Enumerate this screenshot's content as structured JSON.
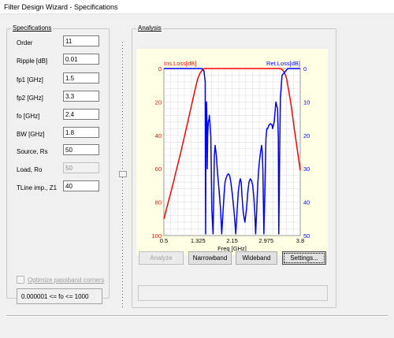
{
  "window": {
    "title": "Filter Design Wizard - Specifications"
  },
  "specifications": {
    "title": "Specifications",
    "fields": [
      {
        "label": "Order",
        "value": "11",
        "enabled": true
      },
      {
        "label": "Ripple [dB]",
        "value": "0.01",
        "enabled": true
      },
      {
        "label": "fp1 [GHz]",
        "value": "1.5",
        "enabled": true
      },
      {
        "label": "fp2 [GHz]",
        "value": "3.3",
        "enabled": true
      },
      {
        "label": "fo [GHz]",
        "value": "2.4",
        "enabled": true
      },
      {
        "label": "BW [GHz]",
        "value": "1.8",
        "enabled": true
      },
      {
        "label": "Source, Rs",
        "value": "50",
        "enabled": true
      },
      {
        "label": "Load, Ro",
        "value": "50",
        "enabled": false
      },
      {
        "label": "TLine imp., Z1",
        "value": "40",
        "enabled": true
      }
    ],
    "optimize_checkbox": {
      "label": "Optimize passband corners",
      "checked": false,
      "enabled": false
    },
    "range_status": "0.000001 <= fo <= 1000"
  },
  "analysis": {
    "title": "Analysis",
    "buttons": {
      "analyze": "Analyze",
      "narrowband": "Narrowband",
      "wideband": "Wideband",
      "settings": "Settings..."
    },
    "message": ""
  },
  "chart_data": {
    "type": "line",
    "title": "",
    "xlabel": "Freq [GHz]",
    "xlim": [
      0.5,
      3.8
    ],
    "x_ticks": [
      "0.5",
      "1.325",
      "2.15",
      "2.975",
      "3.8"
    ],
    "left_axis": {
      "label": "Ins.Loss[dB]",
      "lim": [
        0,
        100
      ],
      "inverted": true,
      "ticks": [
        "0",
        "20",
        "40",
        "60",
        "80",
        "100"
      ],
      "color": "#ff0000"
    },
    "right_axis": {
      "label": "Ret.Loss[dB]",
      "lim": [
        0,
        50
      ],
      "inverted": true,
      "ticks": [
        "0",
        "10",
        "20",
        "30",
        "40",
        "50"
      ],
      "color": "#0000ff"
    },
    "grid": true,
    "series": [
      {
        "name": "Ins.Loss[dB]",
        "axis": "left",
        "color": "#ff0000",
        "x": [
          0.5,
          0.7,
          0.9,
          1.05,
          1.15,
          1.25,
          1.32,
          1.38,
          1.43,
          1.47,
          1.5,
          2.4,
          3.3,
          3.33,
          3.37,
          3.42,
          3.47,
          3.52,
          3.58,
          3.65,
          3.72,
          3.8
        ],
        "y": [
          90,
          71,
          51,
          35,
          24,
          13,
          6,
          2.5,
          0.8,
          0.1,
          0,
          0,
          0,
          0.1,
          0.8,
          2.5,
          6,
          13,
          22,
          35,
          47,
          61
        ]
      },
      {
        "name": "Ret.Loss[dB]",
        "axis": "right",
        "color": "#0000ff",
        "x": [
          0.5,
          1.0,
          1.3,
          1.42,
          1.47,
          1.5,
          1.505,
          1.51,
          1.515,
          1.525,
          1.53,
          1.545,
          1.55,
          1.56,
          1.575,
          1.595,
          1.6,
          1.635,
          1.66,
          1.69,
          1.705,
          1.72,
          1.74,
          1.76,
          1.775,
          1.79,
          1.81,
          1.84,
          1.87,
          1.9,
          1.935,
          1.96,
          1.98,
          2.0,
          2.03,
          2.06,
          2.09,
          2.12,
          2.16,
          2.2,
          2.24,
          2.27,
          2.3,
          2.33,
          2.35,
          2.37,
          2.39,
          2.42,
          2.46,
          2.5,
          2.53,
          2.56,
          2.59,
          2.62,
          2.65,
          2.68,
          2.7,
          2.72,
          2.745,
          2.76,
          2.775,
          2.79,
          2.81,
          2.84,
          2.865,
          2.88,
          2.895,
          2.92,
          2.945,
          2.97,
          2.99,
          3.01,
          3.04,
          3.08,
          3.12,
          3.13,
          3.17,
          3.21,
          3.25,
          3.27,
          3.28,
          3.3,
          3.32,
          3.36,
          3.5,
          3.8
        ],
        "y": [
          0,
          0,
          0,
          0,
          0.8,
          4,
          30,
          49.5,
          30,
          11,
          10,
          18,
          30,
          20,
          16,
          15,
          14,
          20,
          42,
          49.5,
          40,
          26,
          23,
          25,
          27,
          30,
          33,
          37,
          42,
          49.5,
          42,
          37,
          34,
          33,
          32,
          31.5,
          32,
          34,
          38,
          43,
          49.5,
          43,
          37,
          34,
          33,
          34,
          38,
          43,
          46,
          42,
          37,
          34,
          33,
          33.5,
          35,
          39,
          43,
          49.5,
          43,
          38,
          34,
          31,
          28,
          25,
          23,
          25,
          30,
          49.5,
          36,
          21,
          18,
          18,
          17,
          16.5,
          17,
          18,
          16,
          10,
          12,
          21,
          49.5,
          28,
          9,
          2,
          0,
          0
        ]
      }
    ]
  }
}
